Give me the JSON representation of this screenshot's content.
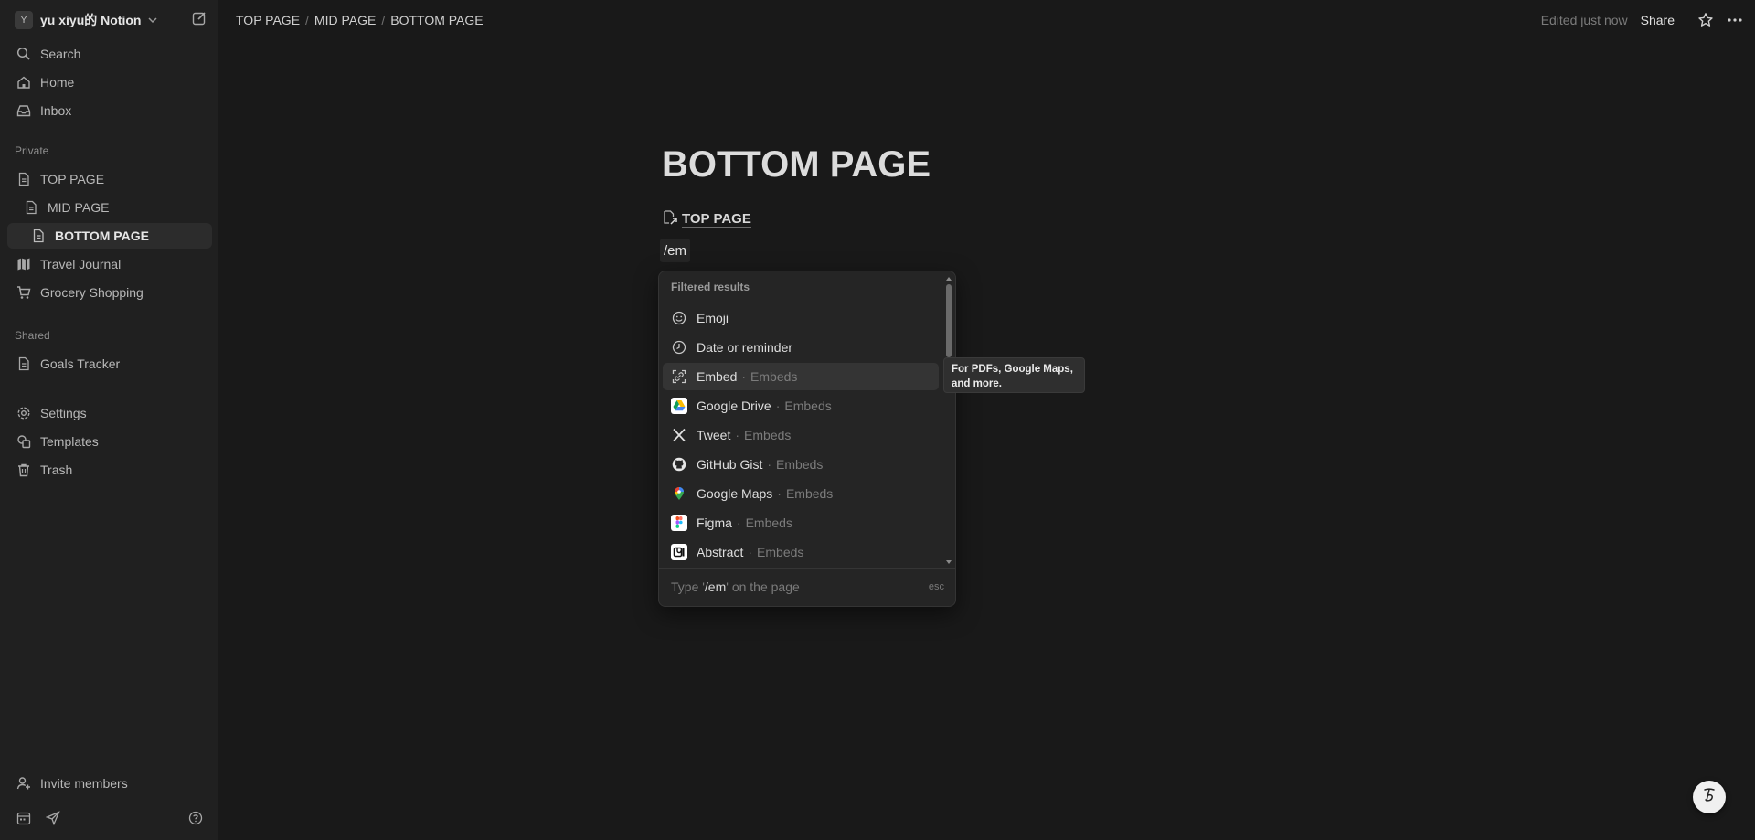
{
  "workspace": {
    "avatar_letter": "Y",
    "name": "yu xiyu的 Notion"
  },
  "sidebar": {
    "top_items": [
      {
        "label": "Search",
        "icon": "search-icon"
      },
      {
        "label": "Home",
        "icon": "home-icon"
      },
      {
        "label": "Inbox",
        "icon": "inbox-icon"
      }
    ],
    "private_label": "Private",
    "private_items": [
      {
        "label": "TOP PAGE",
        "icon": "page-icon"
      },
      {
        "label": "MID PAGE",
        "icon": "page-icon"
      },
      {
        "label": "BOTTOM PAGE",
        "icon": "page-icon",
        "active": true
      },
      {
        "label": "Travel Journal",
        "icon": "map-icon"
      },
      {
        "label": "Grocery Shopping",
        "icon": "cart-icon"
      }
    ],
    "shared_label": "Shared",
    "shared_items": [
      {
        "label": "Goals Tracker",
        "icon": "page-icon"
      }
    ],
    "utility_items": [
      {
        "label": "Settings",
        "icon": "gear-icon"
      },
      {
        "label": "Templates",
        "icon": "templates-icon"
      },
      {
        "label": "Trash",
        "icon": "trash-icon"
      }
    ],
    "invite_label": "Invite members"
  },
  "breadcrumb": [
    "TOP PAGE",
    "MID PAGE",
    "BOTTOM PAGE"
  ],
  "topbar": {
    "edited": "Edited just now",
    "share": "Share"
  },
  "page": {
    "title": "BOTTOM PAGE",
    "link_label": "TOP PAGE",
    "slash_text": "/em"
  },
  "menu": {
    "header": "Filtered results",
    "items": [
      {
        "label": "Emoji",
        "sub": "",
        "icon": "emoji-icon"
      },
      {
        "label": "Date or reminder",
        "sub": "",
        "icon": "clock-icon"
      },
      {
        "label": "Embed",
        "sub": "Embeds",
        "icon": "embed-icon",
        "highlighted": true
      },
      {
        "label": "Google Drive",
        "sub": "Embeds",
        "icon": "google-drive-icon"
      },
      {
        "label": "Tweet",
        "sub": "Embeds",
        "icon": "x-icon"
      },
      {
        "label": "GitHub Gist",
        "sub": "Embeds",
        "icon": "github-icon"
      },
      {
        "label": "Google Maps",
        "sub": "Embeds",
        "icon": "google-maps-icon"
      },
      {
        "label": "Figma",
        "sub": "Embeds",
        "icon": "figma-icon"
      },
      {
        "label": "Abstract",
        "sub": "Embeds",
        "icon": "abstract-icon"
      }
    ],
    "footer_prefix": "Type '",
    "footer_query": "/em",
    "footer_suffix": "' on the page",
    "footer_esc": "esc"
  },
  "tooltip": {
    "line1": "For PDFs, Google Maps,",
    "line2": "and more."
  }
}
